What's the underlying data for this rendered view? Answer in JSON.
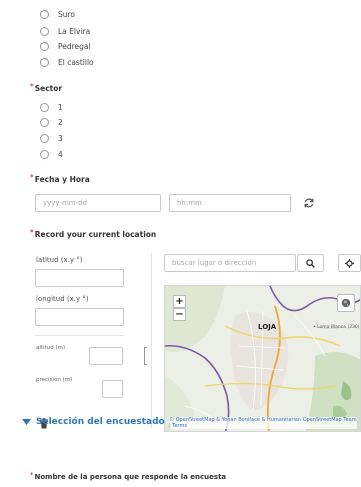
{
  "municipality_options": [
    "Suro",
    "La Elvira",
    "Pedregal",
    "El castillo"
  ],
  "sector": {
    "required_mark": "*",
    "label": "Sector",
    "options": [
      "1",
      "2",
      "3",
      "4"
    ]
  },
  "fecha_hora": {
    "required_mark": "*",
    "label": "Fecha y Hora",
    "date_placeholder": "yyyy-mm-dd",
    "time_placeholder": "hh:mm"
  },
  "location": {
    "required_mark": "*",
    "label": "Record your current location",
    "latitude_label": "latitud (x.y °)",
    "longitude_label": "longitud (x.y °)",
    "altitude_label": "altitud (m)",
    "precision_label": "precisión (m)",
    "search_placeholder": "buscar lugar o dirección",
    "map": {
      "zoom_in": "+",
      "zoom_out": "−",
      "city_label": "LOJA",
      "place_label": "• Loma Blanca (230)",
      "attribution": "© OpenStreetMap & Yohan Boniface & Humanitarian OpenStreetMap Team | Terms"
    }
  },
  "section": {
    "title": "Selección del encuestado"
  },
  "respondent": {
    "required_mark": "*",
    "label": "Nombre de la persona que responde la encuesta"
  },
  "colors": {
    "accent": "#2f78b8",
    "required": "#c8102e",
    "border": "#c9c9c9"
  }
}
